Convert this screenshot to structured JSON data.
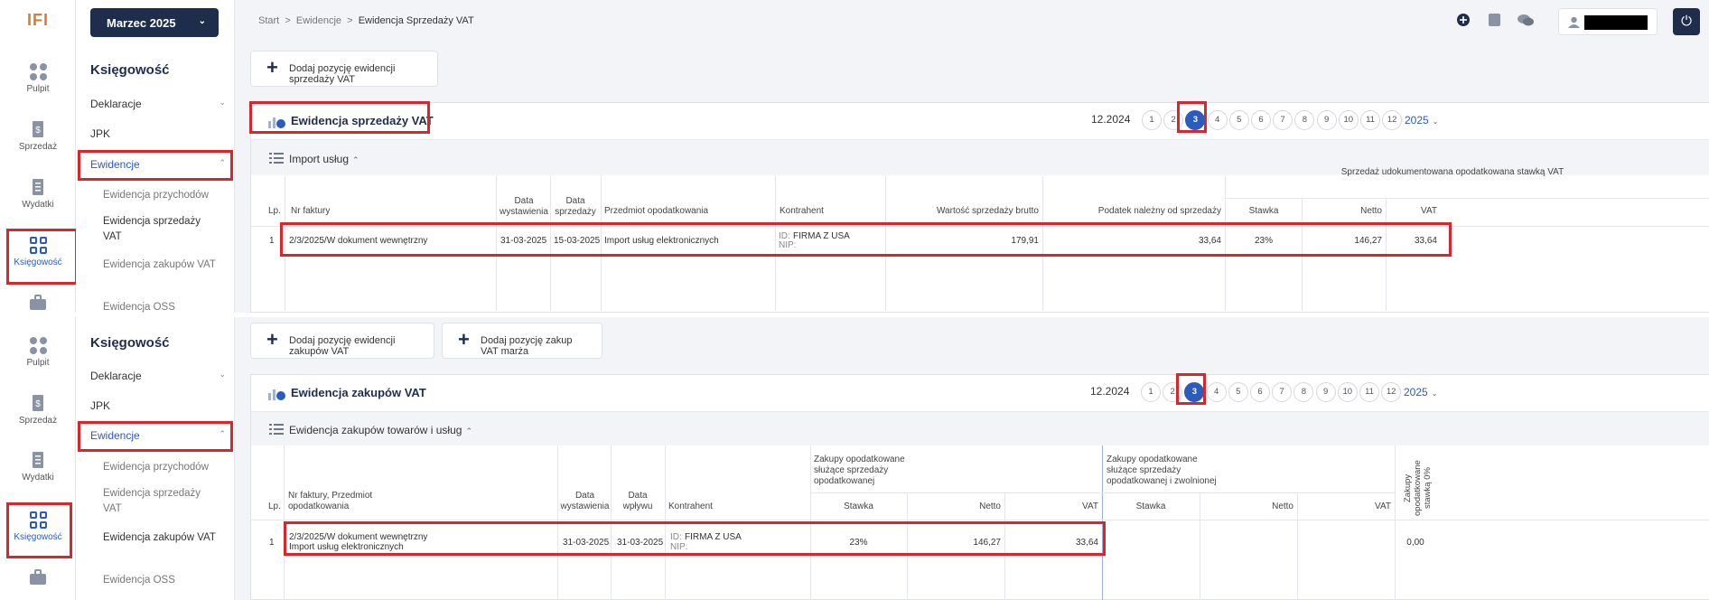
{
  "app": {
    "logo": "IFI"
  },
  "rail": {
    "items": [
      {
        "label": "Pulpit",
        "icon": "dashboard-dots-icon"
      },
      {
        "label": "Sprzedaż",
        "icon": "invoice-dollar-icon"
      },
      {
        "label": "Wydatki",
        "icon": "receipt-icon"
      },
      {
        "label": "Księgowość",
        "icon": "grid-icon"
      }
    ]
  },
  "submenu": {
    "month": "Marzec 2025",
    "title": "Księgowość",
    "items": [
      "Deklaracje",
      "JPK",
      "Ewidencje"
    ],
    "leaves": [
      "Ewidencja przychodów",
      "Ewidencja sprzedaży VAT",
      "Ewidencja zakupów VAT",
      "Ewidencja OSS"
    ]
  },
  "breadcrumb": [
    "Start",
    "Ewidencje",
    "Ewidencja Sprzedaży VAT"
  ],
  "sales": {
    "add_button": "Dodaj pozycję ewidencji sprzedaży VAT",
    "title": "Ewidencja sprzedaży VAT",
    "period": "12.2024",
    "months": [
      "1",
      "2",
      "3",
      "4",
      "5",
      "6",
      "7",
      "8",
      "9",
      "10",
      "11",
      "12"
    ],
    "selected_month": "3",
    "year": "2025",
    "section": "Import usług",
    "group_header": "Sprzedaż udokumentowana opodatkowana stawką VAT",
    "headers": [
      "Lp.",
      "Nr faktury",
      "Data wystawienia",
      "Data sprzedaży",
      "Przedmiot opodatkowania",
      "Kontrahent",
      "Wartość sprzedaży brutto",
      "Podatek należny od sprzedaży",
      "Stawka",
      "Netto",
      "VAT"
    ],
    "row": {
      "lp": "1",
      "nr": "2/3/2025/W dokument wewnętrzny",
      "data_wyst": "31-03-2025",
      "data_sprz": "15-03-2025",
      "przedmiot": "Import usług elektronicznych",
      "id_label": "ID:",
      "kontrahent": "FIRMA Z USA",
      "nip_label": "NIP:",
      "brutto": "179,91",
      "podatek": "33,64",
      "stawka": "23%",
      "netto": "146,27",
      "vat": "33,64"
    }
  },
  "purchases": {
    "add_button": "Dodaj pozycję ewidencji zakupów VAT",
    "add_button2": "Dodaj pozycję zakup VAT marża",
    "title": "Ewidencja zakupów VAT",
    "period": "12.2024",
    "months": [
      "1",
      "2",
      "3",
      "4",
      "5",
      "6",
      "7",
      "8",
      "9",
      "10",
      "11",
      "12"
    ],
    "selected_month": "3",
    "year": "2025",
    "section": "Ewidencja zakupów towarów i usług",
    "group1": "Zakupy opodatkowane służące sprzedaży opodatkowanej",
    "group2": "Zakupy opodatkowane służące sprzedaży opodatkowanej i zwolnionej",
    "group3": "Zakupy opodatkowane stawką 0%",
    "headers": [
      "Lp.",
      "Nr faktury, Przedmiot opodatkowania",
      "Data wystawienia",
      "Data wpływu",
      "Kontrahent",
      "Stawka",
      "Netto",
      "VAT",
      "Stawka",
      "Netto",
      "VAT"
    ],
    "row": {
      "lp": "1",
      "nr": "2/3/2025/W dokument wewnętrzny",
      "przedmiot": "Import usług elektronicznych",
      "data_wyst": "31-03-2025",
      "data_wplywu": "31-03-2025",
      "id_label": "ID:",
      "kontrahent": "FIRMA Z USA",
      "nip_label": "NIP:",
      "stawka": "23%",
      "netto": "146,27",
      "vat": "33,64",
      "zero": "0,00"
    }
  },
  "colors": {
    "accent": "#2b5bbd",
    "navy": "#1f2d4d",
    "highlight": "#d9262c"
  }
}
